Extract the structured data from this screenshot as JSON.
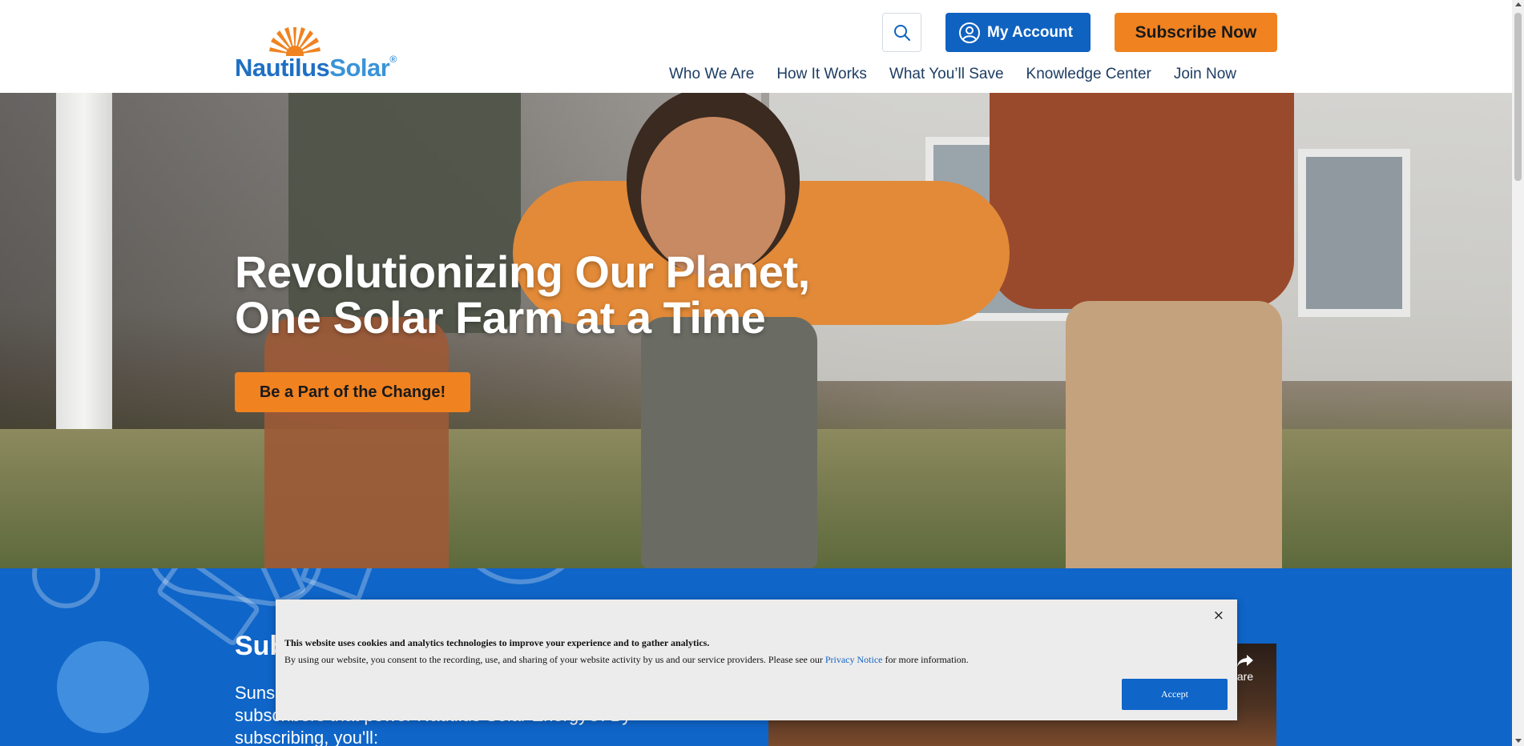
{
  "brand": {
    "logo_part1": "Nautilus",
    "logo_part2": "Solar",
    "logo_mark": "®",
    "colors": {
      "primary_blue": "#0f62c0",
      "accent_orange": "#f08220",
      "nav_text": "#1d3d63"
    }
  },
  "header": {
    "search_icon": "search-icon",
    "account_label": "My Account",
    "account_icon": "user-circle-icon",
    "subscribe_label": "Subscribe Now"
  },
  "nav": {
    "items": [
      "Who We Are",
      "How It Works",
      "What You’ll Save",
      "Knowledge Center",
      "Join Now"
    ]
  },
  "hero": {
    "title_line1": "Revolutionizing Our Planet,",
    "title_line2": "One Solar Farm at a Time",
    "cta_label": "Be a Part of the Change!"
  },
  "subscribe_section": {
    "heading": "Sub",
    "text": "Sunshine. Subscribers are environmentally conscious subscribers that power Nautilus Solar Energy®. By subscribing, you'll:",
    "video_share_label": "are"
  },
  "cookie_banner": {
    "title": "This website uses cookies and analytics technologies to improve your experience and to gather analytics.",
    "body_before": "By using our website, you consent to the recording, use, and sharing of your website activity by us and our service providers. Please see our ",
    "link_text": "Privacy Notice",
    "body_after": " for more information.",
    "close_label": "×",
    "accept_label": "Accept"
  }
}
